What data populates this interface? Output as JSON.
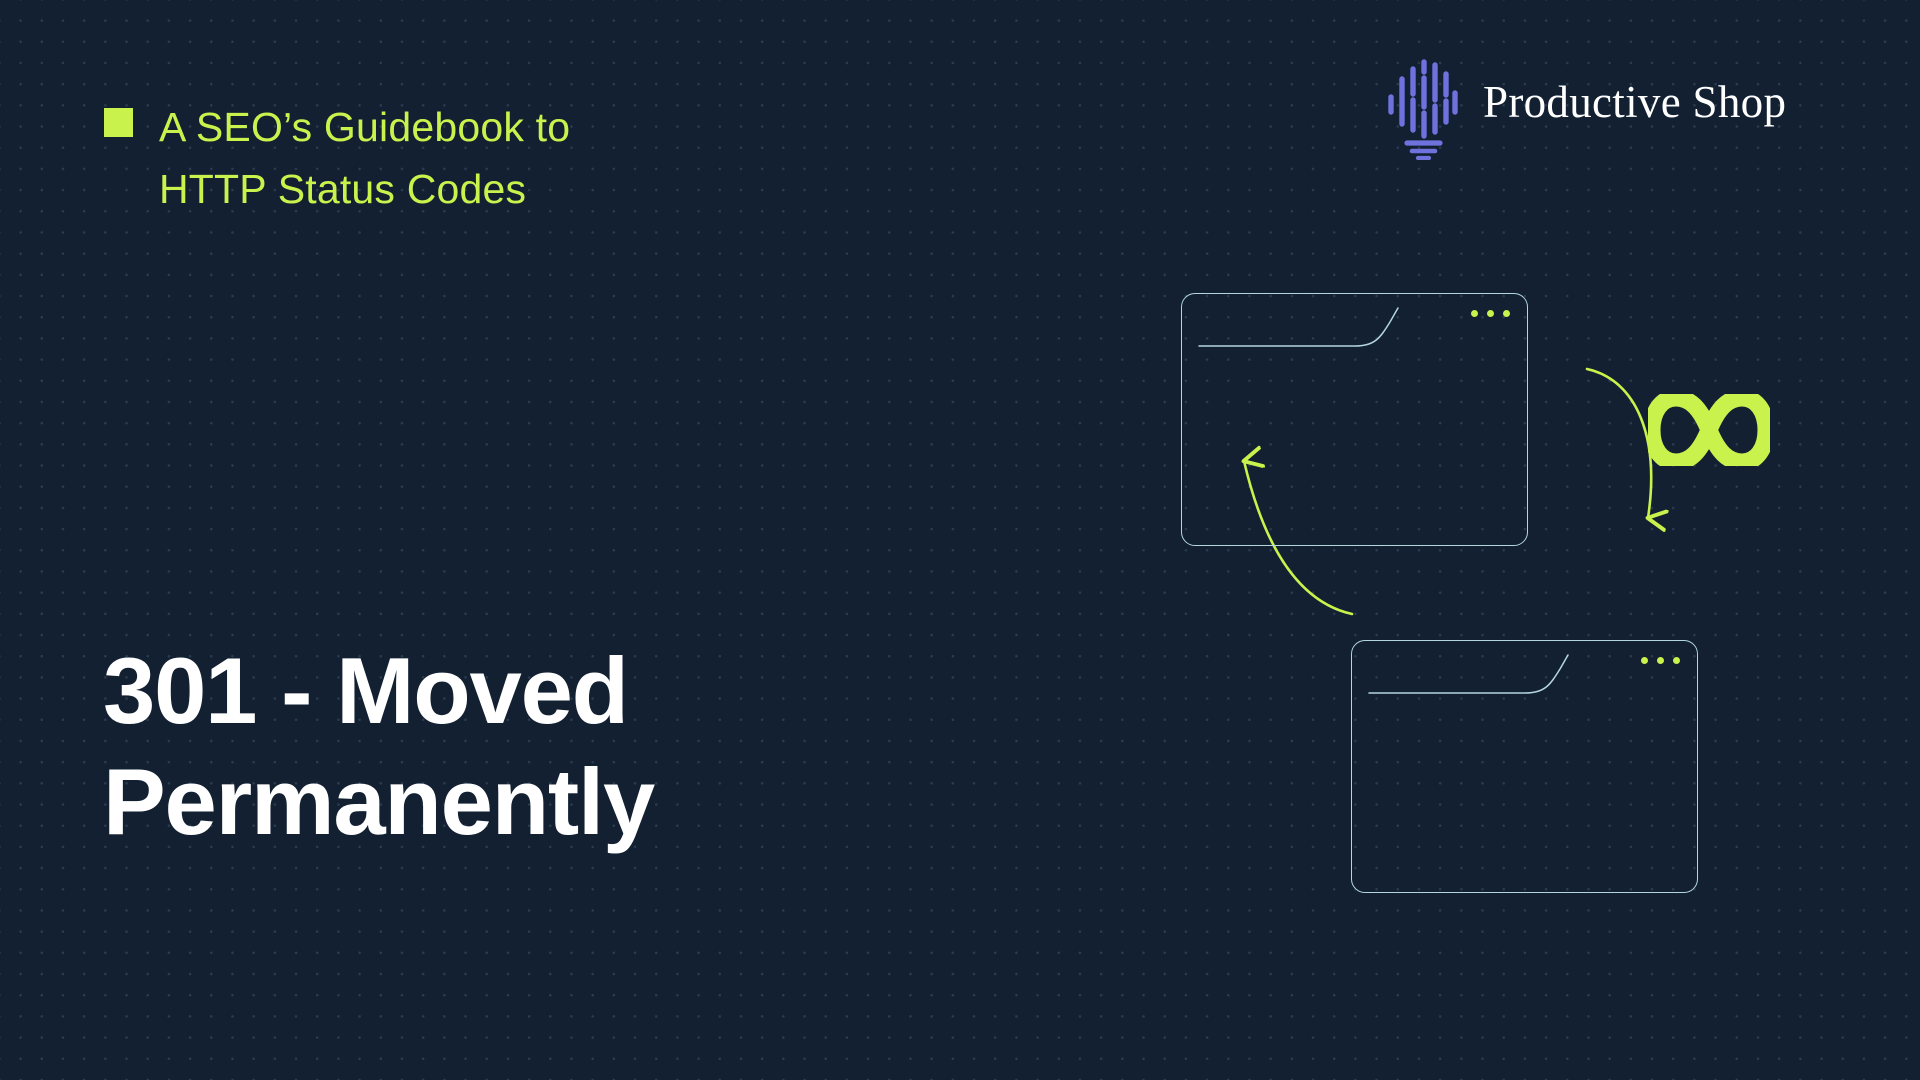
{
  "theme": {
    "background": "#122032",
    "dot_grid": "#2b3c50",
    "accent_green": "#c9f24d",
    "stroke_light_blue": "#b4d6dd",
    "logo_purple": "#6f72dd",
    "text_white": "#ffffff"
  },
  "eyebrow": {
    "marker_icon": "green-square-icon",
    "text": "A SEO’s Guidebook to\nHTTP Status Codes"
  },
  "title": {
    "text": "301 - Moved\nPermanently"
  },
  "brand": {
    "mark_icon": "lightbulb-logo-icon",
    "name": "Productive Shop"
  },
  "illustration": {
    "windows": [
      {
        "name": "source-browser-window",
        "dots": 3
      },
      {
        "name": "destination-browser-window",
        "dots": 3
      }
    ],
    "arrows": [
      {
        "name": "redirect-arrow-down",
        "direction": "down"
      },
      {
        "name": "redirect-arrow-up",
        "direction": "up"
      }
    ],
    "infinity_icon": "infinity-loop-icon"
  }
}
